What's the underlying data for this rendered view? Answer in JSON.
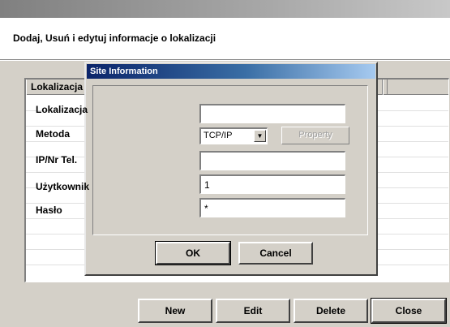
{
  "window": {
    "header_text": "Dodaj, Usuń i edytuj informacje o lokalizacji"
  },
  "list": {
    "column_header": "Lokalizacja"
  },
  "bottom_buttons": {
    "new_label": "New",
    "edit_label": "Edit",
    "delete_label": "Delete",
    "close_label": "Close"
  },
  "dialog": {
    "title": "Site Information",
    "fields": {
      "lokalizacja_label": "Lokalizacja",
      "lokalizacja_value": "",
      "metoda_label": "Metoda",
      "metoda_value": "TCP/IP",
      "property_label": "Property",
      "ip_label": "IP/Nr Tel.",
      "ip_value": "",
      "uzytkownik_label": "Użytkownik",
      "uzytkownik_value": "1",
      "haslo_label": "Hasło",
      "haslo_value": "*"
    },
    "ok_label": "OK",
    "cancel_label": "Cancel"
  }
}
